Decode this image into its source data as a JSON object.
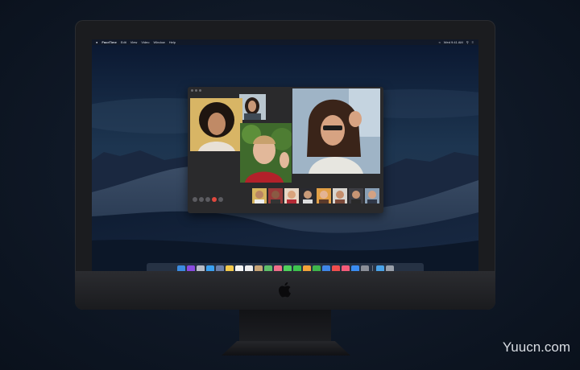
{
  "menubar": {
    "app_name": "FaceTime",
    "items": [
      "Edit",
      "View",
      "Video",
      "Window",
      "Help"
    ],
    "clock": "Wed 9:41 AM"
  },
  "facetime": {
    "controls": [
      "sidebar-icon",
      "mute-icon",
      "camera-icon",
      "end-call-icon",
      "fullscreen-icon"
    ],
    "participant_count": 8
  },
  "dock": {
    "icons": [
      {
        "name": "finder-icon",
        "color": "#3b8be0"
      },
      {
        "name": "siri-icon",
        "color": "#8a4be0"
      },
      {
        "name": "launchpad-icon",
        "color": "#b8bcc6"
      },
      {
        "name": "safari-icon",
        "color": "#3aa0f0"
      },
      {
        "name": "photos-browser-icon",
        "color": "#6b7fa8"
      },
      {
        "name": "notes-icon",
        "color": "#f2c94c"
      },
      {
        "name": "calendar-icon",
        "color": "#f4f4f4"
      },
      {
        "name": "reminders-icon",
        "color": "#eeeeee"
      },
      {
        "name": "contacts-icon",
        "color": "#c9a577"
      },
      {
        "name": "maps-icon",
        "color": "#5fbf6a"
      },
      {
        "name": "photos-icon",
        "color": "#f06e8a"
      },
      {
        "name": "messages-icon",
        "color": "#4fd15c"
      },
      {
        "name": "facetime-icon",
        "color": "#3ec44e"
      },
      {
        "name": "pages-icon",
        "color": "#f2a33a"
      },
      {
        "name": "numbers-icon",
        "color": "#3fb54c"
      },
      {
        "name": "keynote-icon",
        "color": "#3f86e8"
      },
      {
        "name": "news-icon",
        "color": "#f04e4e"
      },
      {
        "name": "music-icon",
        "color": "#f55b7a"
      },
      {
        "name": "app-store-icon",
        "color": "#3a8cf2"
      },
      {
        "name": "system-preferences-icon",
        "color": "#8b8f98"
      },
      {
        "name": "folder-icon",
        "color": "#4aa3e8"
      },
      {
        "name": "trash-icon",
        "color": "#9aa0aa"
      }
    ]
  },
  "watermark": "Yuucn.com"
}
